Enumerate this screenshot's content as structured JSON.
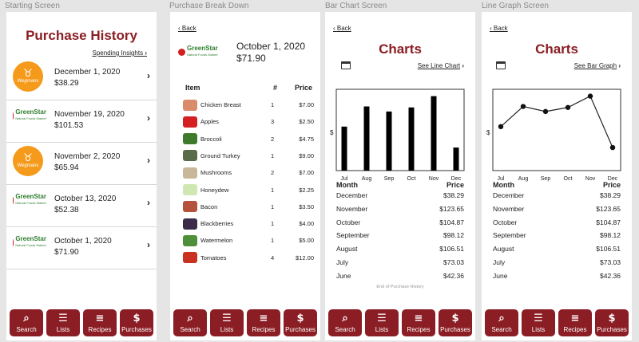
{
  "frames": {
    "start": "Starting Screen",
    "breakdown": "Purchase Break Down",
    "bar": "Bar Chart Screen",
    "line": "Line Graph Screen"
  },
  "colors": {
    "accent": "#8b1e24",
    "orange": "#f59a1a",
    "green": "#2e7d2e"
  },
  "tabs": [
    {
      "icon": "search-icon",
      "glyph": "⌕",
      "label": "Search"
    },
    {
      "icon": "list-icon",
      "glyph": "☰",
      "label": "Lists"
    },
    {
      "icon": "recipes-icon",
      "glyph": "≡",
      "label": "Recipes"
    },
    {
      "icon": "dollar-icon",
      "glyph": "$",
      "label": "Purchases"
    }
  ],
  "start": {
    "title": "Purchase History",
    "insights_link": "Spending Insights",
    "purchases": [
      {
        "logo": "wegmans",
        "date": "December 1, 2020",
        "amount": "$38.29"
      },
      {
        "logo": "greenstar",
        "date": "November 19, 2020",
        "amount": "$101.53"
      },
      {
        "logo": "wegmans",
        "date": "November 2, 2020",
        "amount": "$65.94"
      },
      {
        "logo": "greenstar",
        "date": "October 13, 2020",
        "amount": "$52.38"
      },
      {
        "logo": "greenstar",
        "date": "October 1, 2020",
        "amount": "$71.90"
      }
    ]
  },
  "logos": {
    "wegmans": "Wegmans",
    "greenstar": "GreenStar",
    "greenstar_sub": "Natural Foods Market"
  },
  "breakdown": {
    "back": "Back",
    "date": "October 1, 2020",
    "total": "$71.90",
    "col_item": "Item",
    "col_qty": "#",
    "col_price": "Price",
    "items": [
      {
        "name": "Chicken Breast",
        "qty": "1",
        "price": "$7.00",
        "color": "#d98b6a"
      },
      {
        "name": "Apples",
        "qty": "3",
        "price": "$2.50",
        "color": "#d42020"
      },
      {
        "name": "Broccoli",
        "qty": "2",
        "price": "$4.75",
        "color": "#3f7a2c"
      },
      {
        "name": "Ground Turkey",
        "qty": "1",
        "price": "$9.00",
        "color": "#5a6b4a"
      },
      {
        "name": "Mushrooms",
        "qty": "2",
        "price": "$7.00",
        "color": "#c9b79a"
      },
      {
        "name": "Honeydew",
        "qty": "1",
        "price": "$2.25",
        "color": "#cfe7b0"
      },
      {
        "name": "Bacon",
        "qty": "1",
        "price": "$3.50",
        "color": "#b5523b"
      },
      {
        "name": "Blackberries",
        "qty": "1",
        "price": "$4.00",
        "color": "#3b2d4a"
      },
      {
        "name": "Watermelon",
        "qty": "1",
        "price": "$5.00",
        "color": "#4f8f3a"
      },
      {
        "name": "Tomatoes",
        "qty": "4",
        "price": "$12.00",
        "color": "#c8321e"
      }
    ]
  },
  "charts": {
    "title": "Charts",
    "back": "Back",
    "see_line": "See Line Chart",
    "see_bar": "See Bar Graph",
    "ylabel": "$",
    "col_month": "Month",
    "col_price": "Price",
    "end_note": "End of Purchase History",
    "rows": [
      {
        "month": "December",
        "price": "$38.29"
      },
      {
        "month": "November",
        "price": "$123.65"
      },
      {
        "month": "October",
        "price": "$104.87"
      },
      {
        "month": "September",
        "price": "$98.12"
      },
      {
        "month": "August",
        "price": "$106.51"
      },
      {
        "month": "July",
        "price": "$73.03"
      },
      {
        "month": "June",
        "price": "$42.36"
      }
    ]
  },
  "chart_data": [
    {
      "type": "bar",
      "categories": [
        "Jul",
        "Aug",
        "Sep",
        "Oct",
        "Nov",
        "Dec"
      ],
      "values": [
        73.03,
        106.51,
        98.12,
        104.87,
        123.65,
        38.29
      ],
      "ylabel": "$",
      "ylim": [
        0,
        135
      ],
      "grid": false
    },
    {
      "type": "line",
      "categories": [
        "Jul",
        "Aug",
        "Sep",
        "Oct",
        "Nov",
        "Dec"
      ],
      "values": [
        73.03,
        106.51,
        98.12,
        104.87,
        123.65,
        38.29
      ],
      "ylabel": "$",
      "ylim": [
        0,
        135
      ],
      "grid": false
    }
  ]
}
